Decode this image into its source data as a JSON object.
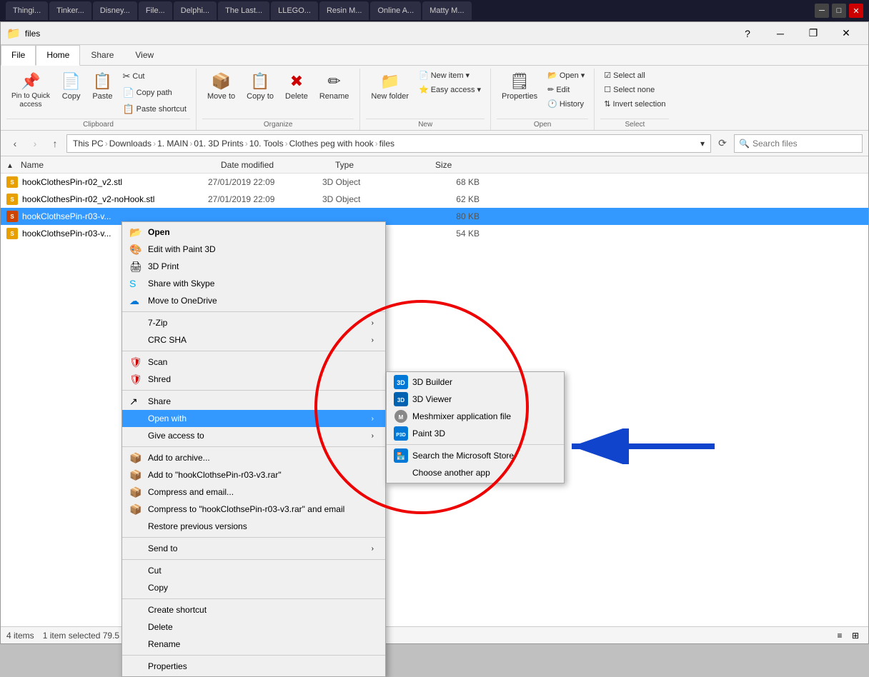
{
  "titlebar": {
    "tabs": [
      "Thingi...",
      "Tinker...",
      "Disney...",
      "File...",
      "Delphi...",
      "The Last...",
      "LLEGO...",
      "Resin M...",
      "Online A...",
      "Matty M..."
    ],
    "app_icon": "📁",
    "title": "files"
  },
  "ribbon": {
    "tabs": [
      "File",
      "Home",
      "Share",
      "View"
    ],
    "active_tab": "Home",
    "groups": {
      "clipboard": {
        "label": "Clipboard",
        "pin_label": "Pin to Quick\naccess",
        "copy_label": "Copy",
        "paste_label": "Paste",
        "cut_label": "Cut",
        "copy_path_label": "Copy path",
        "paste_shortcut_label": "Paste shortcut"
      },
      "organize": {
        "label": "Organize",
        "move_to_label": "Move to",
        "copy_to_label": "Copy to",
        "delete_label": "Delete",
        "rename_label": "Rename"
      },
      "new": {
        "label": "New",
        "new_item_label": "New item",
        "easy_access_label": "Easy access",
        "new_folder_label": "New folder"
      },
      "open": {
        "label": "Open",
        "open_label": "Open",
        "edit_label": "Edit",
        "history_label": "History",
        "properties_label": "Properties"
      },
      "select": {
        "label": "Select",
        "select_all_label": "Select all",
        "select_none_label": "Select none",
        "invert_label": "Invert selection"
      }
    }
  },
  "address": {
    "path": "This PC › Downloads › 1. MAIN › 01. 3D Prints › 10. Tools › Clothes peg with hook › files",
    "search_placeholder": "Search files"
  },
  "columns": {
    "name": "Name",
    "date": "Date modified",
    "type": "Type",
    "size": "Size"
  },
  "files": [
    {
      "name": "hookClothesPin-r02_v2.stl",
      "date": "27/01/2019 22:09",
      "type": "3D Object",
      "size": "68 KB",
      "selected": false
    },
    {
      "name": "hookClothesPin-r02_v2-noHook.stl",
      "date": "27/01/2019 22:09",
      "type": "3D Object",
      "size": "62 KB",
      "selected": false
    },
    {
      "name": "hookClothsePin-r03-v...",
      "date": "",
      "type": "",
      "size": "80 KB",
      "selected": true,
      "highlighted": true
    },
    {
      "name": "hookClothsePin-r03-v...",
      "date": "",
      "type": "",
      "size": "54 KB",
      "selected": false
    }
  ],
  "context_menu": {
    "items": [
      {
        "label": "Open",
        "bold": true,
        "icon": ""
      },
      {
        "label": "Edit with Paint 3D",
        "icon": ""
      },
      {
        "label": "3D Print",
        "icon": ""
      },
      {
        "label": "Share with Skype",
        "icon": "skype"
      },
      {
        "label": "Move to OneDrive",
        "icon": "onedrive"
      },
      {
        "label": "7-Zip",
        "icon": "",
        "arrow": true
      },
      {
        "label": "CRC SHA",
        "icon": "",
        "arrow": true
      },
      {
        "label": "Scan",
        "icon": "scan",
        "separator_before": true
      },
      {
        "label": "Shred",
        "icon": "shred"
      },
      {
        "label": "Share",
        "icon": "share",
        "separator_before": true
      },
      {
        "label": "Open with",
        "icon": "",
        "arrow": true,
        "active": true
      },
      {
        "label": "Give access to",
        "icon": "",
        "arrow": true
      },
      {
        "label": "Add to archive...",
        "icon": "archive",
        "separator_before": true
      },
      {
        "label": "Add to \"hookClothsePin-r03-v3.rar\"",
        "icon": "archive"
      },
      {
        "label": "Compress and email...",
        "icon": "archive"
      },
      {
        "label": "Compress to \"hookClothsePin-r03-v3.rar\" and email",
        "icon": "archive"
      },
      {
        "label": "Restore previous versions",
        "icon": ""
      },
      {
        "label": "Send to",
        "icon": "",
        "arrow": true,
        "separator_before": true
      },
      {
        "label": "Cut",
        "icon": "cut",
        "separator_before": true
      },
      {
        "label": "Copy",
        "icon": "copy"
      },
      {
        "label": "Create shortcut",
        "icon": "",
        "separator_before": true
      },
      {
        "label": "Delete",
        "icon": ""
      },
      {
        "label": "Rename",
        "icon": ""
      },
      {
        "label": "Properties",
        "icon": "",
        "separator_before": true
      }
    ]
  },
  "submenu": {
    "items": [
      {
        "label": "3D Builder",
        "icon": "3dbuilder"
      },
      {
        "label": "3D Viewer",
        "icon": "3dviewer"
      },
      {
        "label": "Meshmixer application file",
        "icon": "meshmixer"
      },
      {
        "label": "Paint 3D",
        "icon": "paint3d"
      },
      {
        "label": "Search the Microsoft Store",
        "icon": "store"
      },
      {
        "label": "Choose another app",
        "icon": ""
      }
    ]
  },
  "status": {
    "item_count": "4 items",
    "selection": "1 item selected  79.5 KB"
  }
}
